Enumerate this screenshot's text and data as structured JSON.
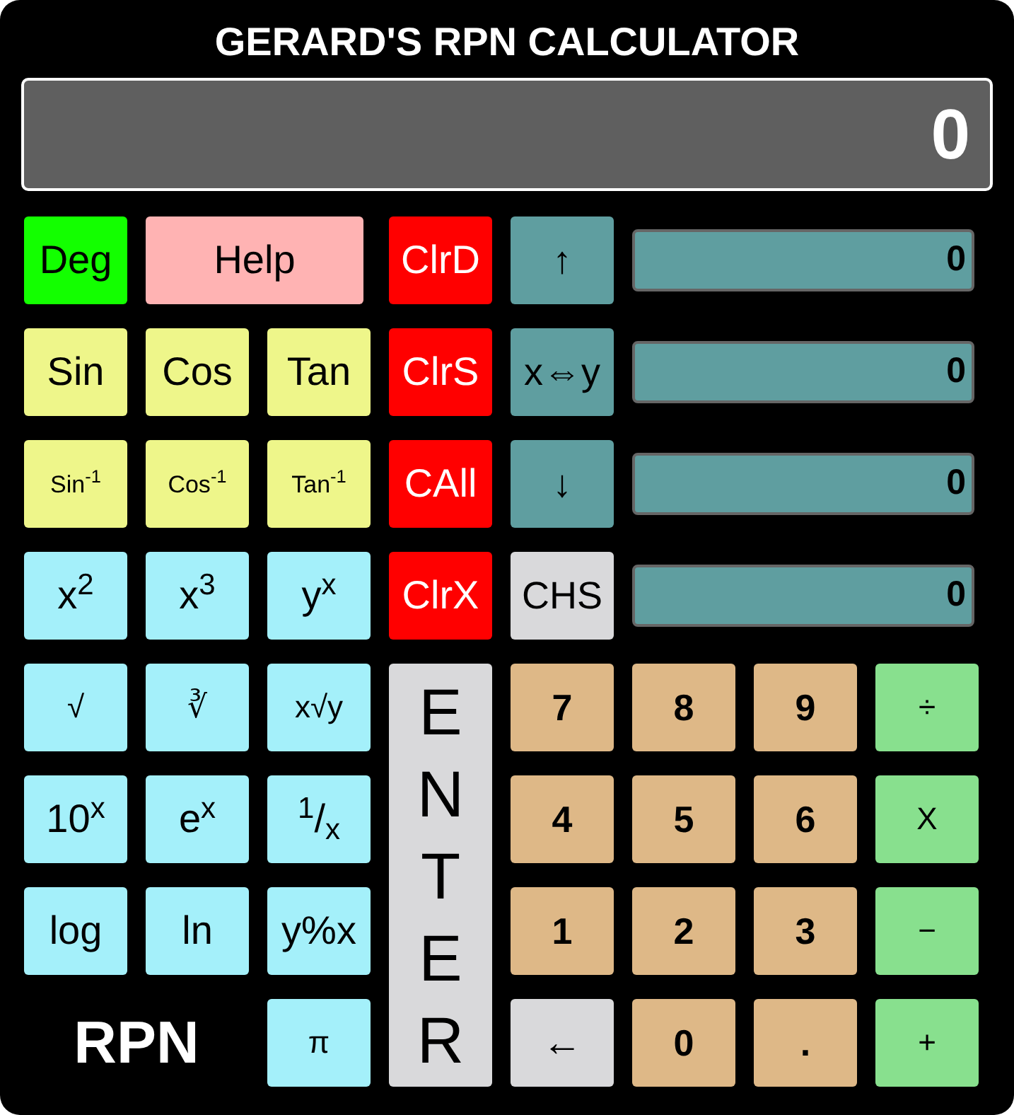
{
  "title": "GERARD'S RPN CALCULATOR",
  "display": {
    "value": "0"
  },
  "left_keys": [
    {
      "label": "Deg",
      "kind": "mode"
    },
    {
      "label": "Help",
      "kind": "help"
    },
    {
      "label": "Sin",
      "kind": "trig"
    },
    {
      "label": "Cos",
      "kind": "trig"
    },
    {
      "label": "Tan",
      "kind": "trig"
    },
    {
      "label": "Sin$^{-1}$",
      "kind": "arc"
    },
    {
      "label": "Cos$^{-1}$",
      "kind": "arc"
    },
    {
      "label": "Tan$^{-1}$",
      "kind": "arc"
    },
    {
      "label": "x$^{2}$",
      "kind": "function"
    },
    {
      "label": "x$^{3}$",
      "kind": "function"
    },
    {
      "label": "y$^{x}$",
      "kind": "function"
    },
    {
      "label": "√",
      "kind": "root"
    },
    {
      "label": "∛",
      "kind": "root"
    },
    {
      "label": "x√y",
      "kind": "root"
    },
    {
      "label": "10$^{x}$",
      "kind": "function"
    },
    {
      "label": "e$^{x}$",
      "kind": "function"
    },
    {
      "label": "$^{1}$/$_{x}$",
      "kind": "function"
    },
    {
      "label": "log",
      "kind": "function"
    },
    {
      "label": "ln",
      "kind": "function"
    },
    {
      "label": "y%x",
      "kind": "function"
    },
    {
      "label": "π",
      "kind": "constant"
    }
  ],
  "mode_label": "RPN",
  "clear_keys": [
    {
      "label": "ClrD",
      "kind": "clear"
    },
    {
      "label": "ClrS",
      "kind": "clear"
    },
    {
      "label": "CAll",
      "kind": "clear"
    },
    {
      "label": "ClrX",
      "kind": "clear"
    }
  ],
  "enter_key": {
    "label": "ENTER"
  },
  "stack_keys": [
    {
      "label": "↑",
      "kind": "stack"
    },
    {
      "label": "x⇔y",
      "kind": "stack"
    },
    {
      "label": "↓",
      "kind": "stack"
    },
    {
      "label": "CHS",
      "kind": "sign"
    }
  ],
  "stack_registers": [
    {
      "value": "0"
    },
    {
      "value": "0"
    },
    {
      "value": "0"
    },
    {
      "value": "0"
    }
  ],
  "keypad": [
    {
      "label": "7",
      "kind": "digit"
    },
    {
      "label": "8",
      "kind": "digit"
    },
    {
      "label": "9",
      "kind": "digit"
    },
    {
      "label": "÷",
      "kind": "operator"
    },
    {
      "label": "4",
      "kind": "digit"
    },
    {
      "label": "5",
      "kind": "digit"
    },
    {
      "label": "6",
      "kind": "digit"
    },
    {
      "label": "X",
      "kind": "operator"
    },
    {
      "label": "1",
      "kind": "digit"
    },
    {
      "label": "2",
      "kind": "digit"
    },
    {
      "label": "3",
      "kind": "digit"
    },
    {
      "label": "−",
      "kind": "operator"
    },
    {
      "label": "←",
      "kind": "back"
    },
    {
      "label": "0",
      "kind": "digit"
    },
    {
      "label": ".",
      "kind": "digit"
    },
    {
      "label": "+",
      "kind": "operator"
    }
  ]
}
